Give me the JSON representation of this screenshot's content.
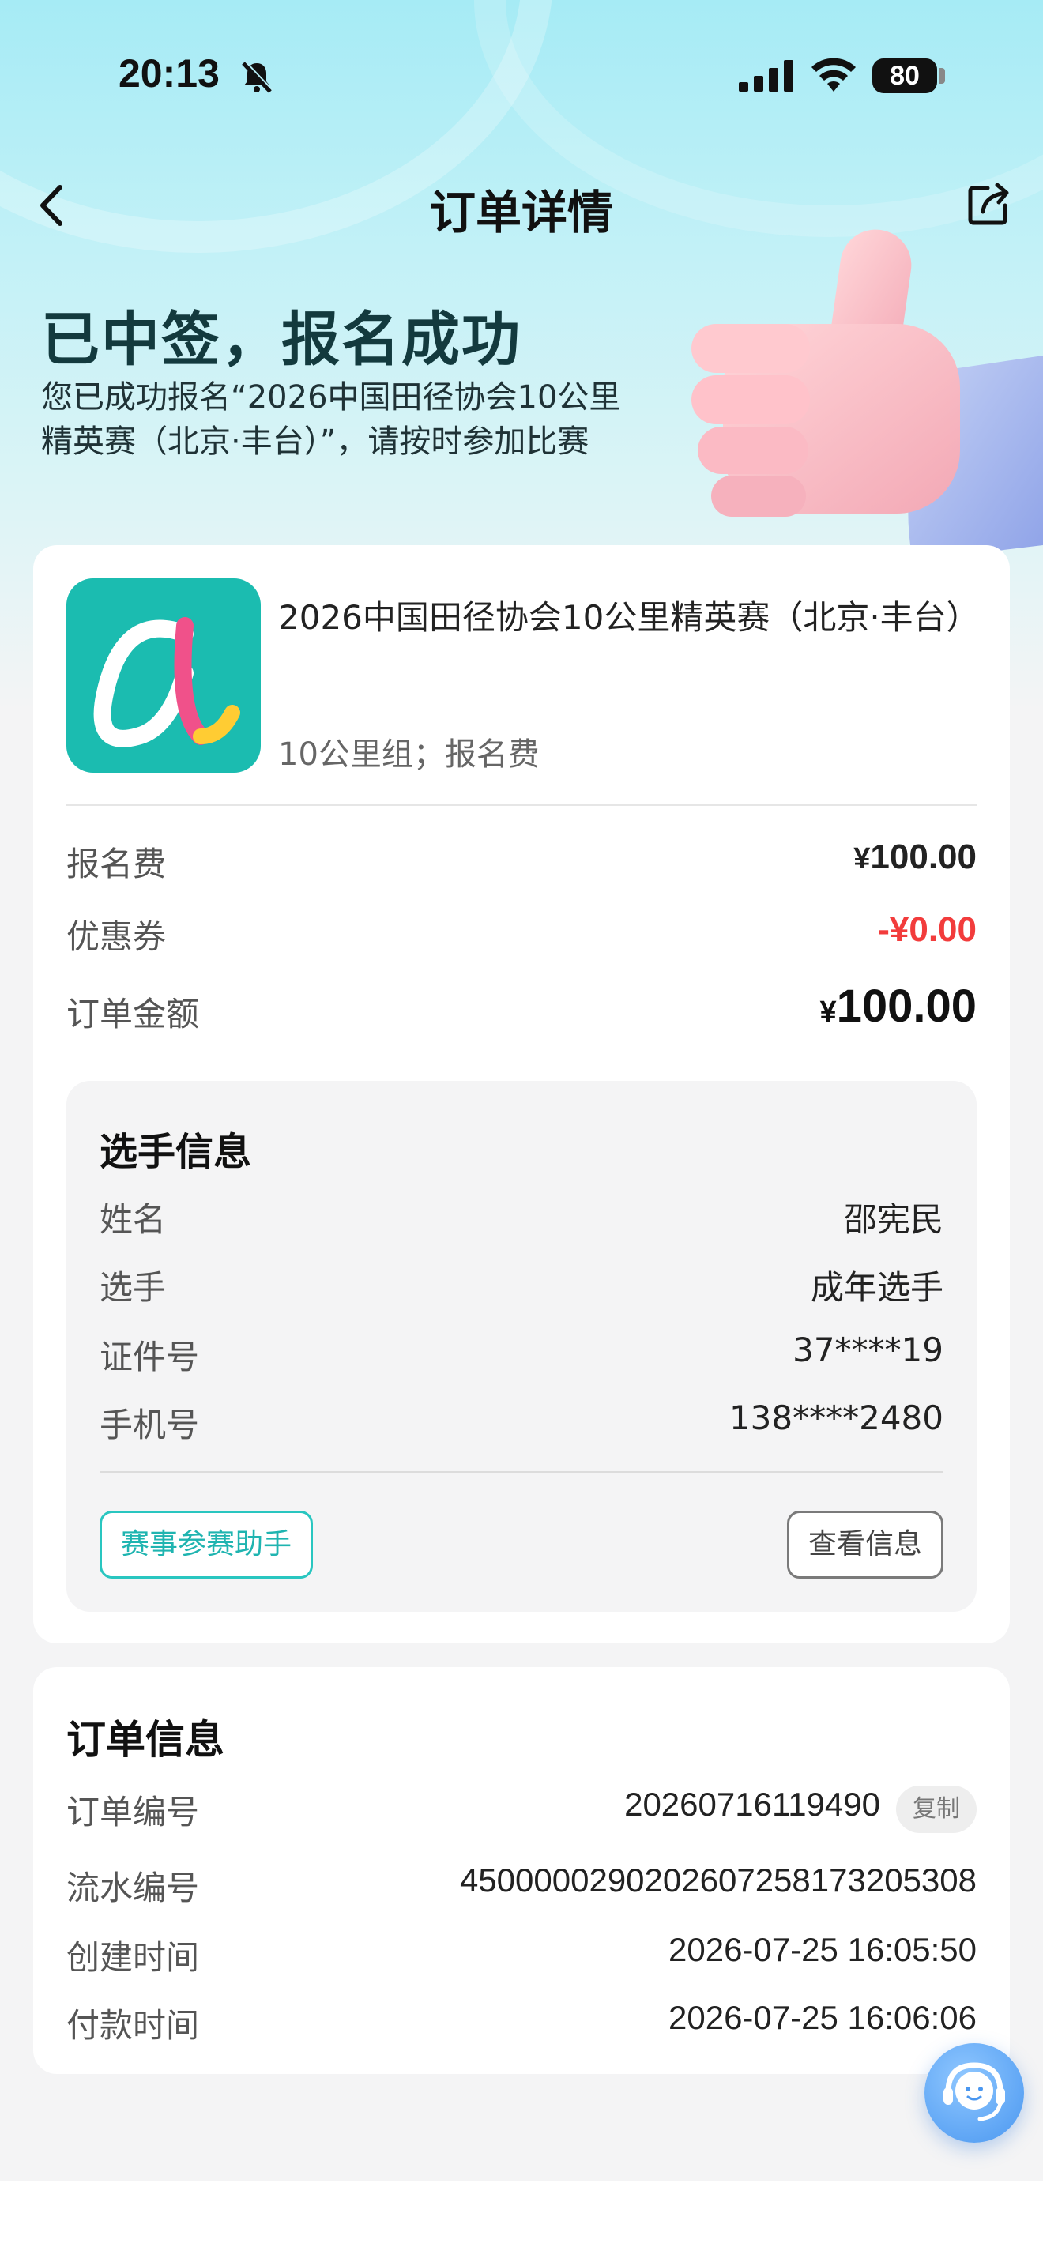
{
  "status_bar": {
    "time": "20:13",
    "battery": "80",
    "icons": [
      "bell-muted-icon",
      "signal-icon",
      "wifi-icon",
      "battery-icon"
    ]
  },
  "nav": {
    "title": "订单详情",
    "back_icon": "chevron-left-icon",
    "share_icon": "share-icon"
  },
  "hero": {
    "title": "已中签，报名成功",
    "subtitle_line1": "您已成功报名“2026中国田径协会10公里",
    "subtitle_line2": "精英赛（北京·丰台）”，请按时参加比赛"
  },
  "order": {
    "event_name": "2026中国田径协会10公里精英赛（北京·丰台）",
    "event_group": "10公里组；报名费",
    "fee_label": "报名费",
    "fee_value": "100.00",
    "coupon_label": "优惠券",
    "coupon_value": "-¥0.00",
    "total_label": "订单金额",
    "total_value": "100.00",
    "currency": "¥"
  },
  "player": {
    "title": "选手信息",
    "rows": [
      {
        "label": "姓名",
        "value": "邵宪民"
      },
      {
        "label": "选手",
        "value": "成年选手"
      },
      {
        "label": "证件号",
        "value": "37****19"
      },
      {
        "label": "手机号",
        "value": "138****2480"
      }
    ],
    "assistant_button": "赛事参赛助手",
    "view_button": "查看信息"
  },
  "order_info": {
    "title": "订单信息",
    "copy_label": "复制",
    "rows": [
      {
        "label": "订单编号",
        "value": "20260716119490"
      },
      {
        "label": "流水编号",
        "value": "4500000290202607258173205308"
      },
      {
        "label": "创建时间",
        "value": "2026-07-25 16:05:50"
      },
      {
        "label": "付款时间",
        "value": "2026-07-25 16:06:06"
      }
    ]
  },
  "floating": {
    "icon": "customer-service-icon"
  },
  "colors": {
    "accent": "#29c6c0",
    "discount": "#f23c3c",
    "logo_bg": "#1bbcb0",
    "service_button": "#4a97f0"
  }
}
